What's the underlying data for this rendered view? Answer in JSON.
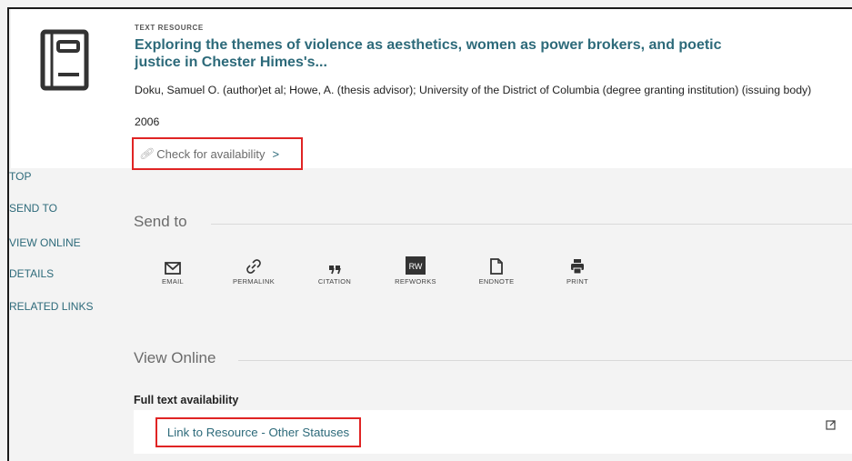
{
  "record": {
    "type_label": "TEXT RESOURCE",
    "title": "Exploring the themes of violence as aesthetics, women as power brokers, and poetic justice in Chester Himes's...",
    "authors": "Doku, Samuel O. (author)et al; Howe, A. (thesis advisor); University of the District of Columbia (degree granting institution) (issuing body)",
    "year": "2006",
    "availability_label": "Check for availability",
    "availability_chevron": ">",
    "icon": "book-icon"
  },
  "sidenav": {
    "items": [
      {
        "label": "TOP"
      },
      {
        "label": "SEND TO"
      },
      {
        "label": "VIEW ONLINE"
      },
      {
        "label": "DETAILS"
      },
      {
        "label": "RELATED LINKS"
      }
    ]
  },
  "send_to": {
    "title": "Send to",
    "tools": [
      {
        "label": "EMAIL",
        "icon": "envelope-icon"
      },
      {
        "label": "PERMALINK",
        "icon": "link-icon"
      },
      {
        "label": "CITATION",
        "icon": "quote-icon"
      },
      {
        "label": "REFWORKS",
        "icon": "refworks-icon",
        "badge": "RW"
      },
      {
        "label": "ENDNOTE",
        "icon": "document-icon"
      },
      {
        "label": "PRINT",
        "icon": "printer-icon"
      }
    ]
  },
  "view_online": {
    "title": "View Online",
    "availability_heading": "Full text availability",
    "link_label": "Link to Resource - Other Statuses",
    "external_icon": "external-link-icon"
  },
  "colors": {
    "accent": "#2d6a7a",
    "highlight_box": "#e02424",
    "background": "#f3f3f3"
  }
}
